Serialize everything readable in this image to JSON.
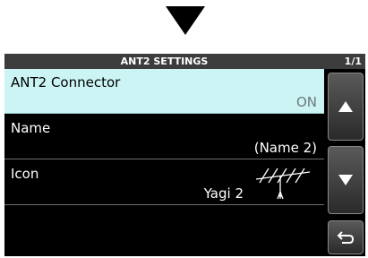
{
  "screen": {
    "title": "ANT2 SETTINGS",
    "page_indicator": "1/1"
  },
  "rows": [
    {
      "label": "ANT2 Connector",
      "value": "ON",
      "selected": true
    },
    {
      "label": "Name",
      "value": "(Name 2)"
    },
    {
      "label": "Icon",
      "value": "Yagi 2",
      "icon": "yagi-antenna-icon"
    }
  ],
  "side_buttons": {
    "up": "up-arrow-icon",
    "down": "down-arrow-icon",
    "back": "return-icon"
  },
  "colors": {
    "selected_row": "#ccf4f4",
    "titlebar": "#3c3c3c",
    "background": "#000000"
  }
}
